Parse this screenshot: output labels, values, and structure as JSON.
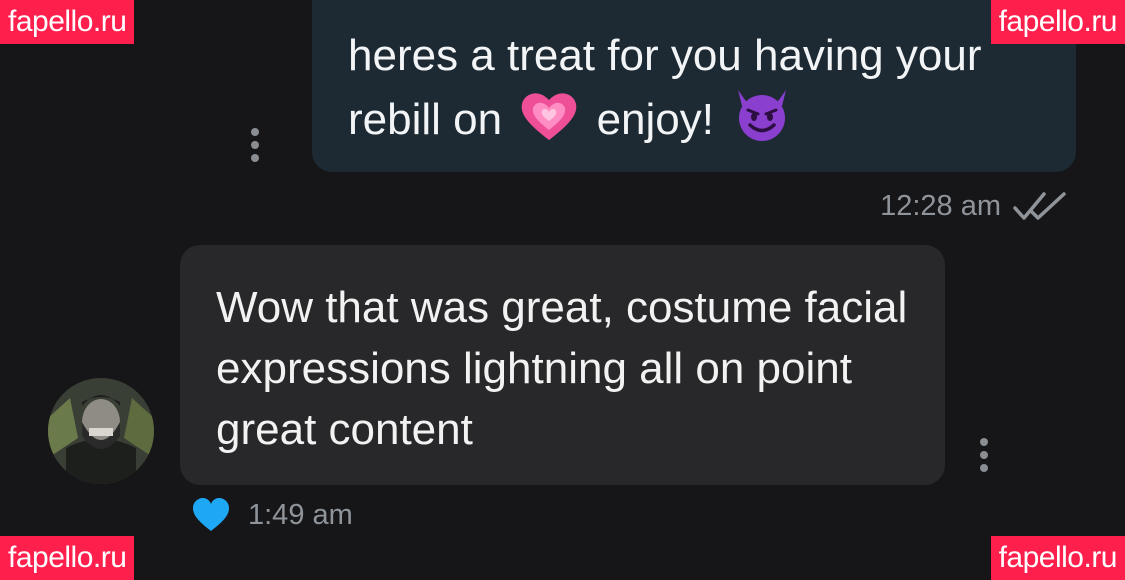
{
  "conversation": {
    "outgoing": {
      "text_before_heart": "heres a treat for you having your",
      "text_line2_start": "rebill on",
      "text_line2_mid": "enjoy!",
      "emoji_heart": "💗",
      "emoji_devil": "😈",
      "time": "12:28 am",
      "status_icon": "double-check-icon"
    },
    "incoming": {
      "text": "Wow that was great, costume facial expressions lightning all on point great content",
      "time": "1:49 am",
      "reaction_icon": "heart-icon",
      "reaction_color": "#1ea7f5"
    }
  },
  "watermark": {
    "text": "fapello.ru",
    "color": "#ff1f4d"
  },
  "colors": {
    "background": "#161618",
    "outgoing_bubble": "#1d2a33",
    "incoming_bubble": "#28282a",
    "meta_text": "#8f949a"
  }
}
